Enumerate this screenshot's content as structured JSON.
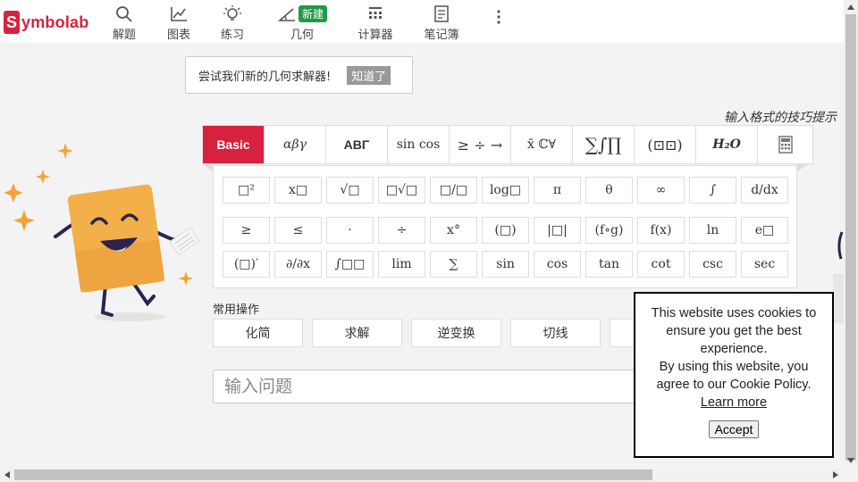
{
  "brand": {
    "logo_s": "S",
    "logo_rest": "ymbolab",
    "color": "#d6223e"
  },
  "nav": {
    "solve": "解题",
    "graph": "图表",
    "practice": "练习",
    "geometry": "几何",
    "geometry_badge": "新建",
    "calculators": "计算器",
    "notebook": "笔记簿"
  },
  "tooltip": {
    "text": "尝试我们新的几何求解器!",
    "button": "知道了"
  },
  "tips_link": "输入格式的技巧提示",
  "keyboard": {
    "tabs": [
      "Basic",
      "αβγ",
      "ΑΒΓ",
      "sin cos",
      "≥ ÷ →",
      "x̄ ℂ∀",
      "∑∫∏",
      "(⊡⊡)",
      "H₂O",
      "calculator-icon"
    ],
    "row1": [
      "□²",
      "x□",
      "√□",
      "□√□",
      "□/□",
      "log□",
      "π",
      "θ",
      "∞",
      "∫",
      "d/dx"
    ],
    "row2": [
      "≥",
      "≤",
      "·",
      "÷",
      "x°",
      "(□)",
      "|□|",
      "(f∘g)",
      "f(x)",
      "ln",
      "e□"
    ],
    "row3": [
      "(□)′",
      "∂/∂x",
      "∫□□",
      "lim",
      "∑",
      "sin",
      "cos",
      "tan",
      "cot",
      "csc",
      "sec"
    ]
  },
  "common_ops": {
    "label": "常用操作",
    "buttons": [
      "化简",
      "求解",
      "逆变换",
      "切线",
      ""
    ]
  },
  "search": {
    "placeholder": "输入问题"
  },
  "cookie": {
    "line1": "This website uses cookies to ensure you get the best experience.",
    "line2": "By using this website, you agree to our Cookie Policy.",
    "learn_more": "Learn more",
    "accept": "Accept"
  }
}
